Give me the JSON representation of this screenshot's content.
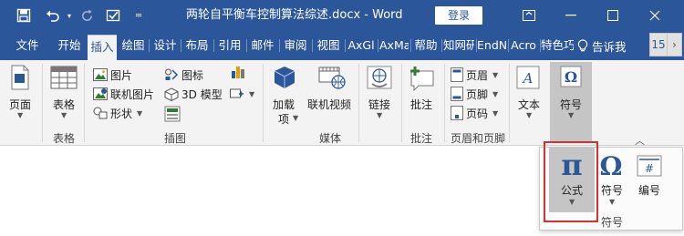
{
  "window": {
    "title": "两轮自平衡车控制算法综述.docx  -  Word",
    "login_label": "登录"
  },
  "quick_access": {
    "save_icon": "save-icon",
    "undo_icon": "undo-icon",
    "redo_icon": "redo-icon",
    "check_icon": "check-icon",
    "customize_icon": "customize-icon"
  },
  "tabs": [
    {
      "label": "文件"
    },
    {
      "label": "开始"
    },
    {
      "label": "插入",
      "active": true
    },
    {
      "label": "绘图"
    },
    {
      "label": "设计"
    },
    {
      "label": "布局"
    },
    {
      "label": "引用"
    },
    {
      "label": "邮件"
    },
    {
      "label": "审阅"
    },
    {
      "label": "视图"
    },
    {
      "label": "AxGl"
    },
    {
      "label": "AxMa"
    },
    {
      "label": "帮助"
    },
    {
      "label": "知网研"
    },
    {
      "label": "EndN"
    },
    {
      "label": "Acro"
    },
    {
      "label": "特色巧"
    }
  ],
  "tell_me": {
    "label": "告诉我"
  },
  "tab_scroll": {
    "label": "15"
  },
  "ribbon": {
    "pages": {
      "label": "页面"
    },
    "tables": {
      "label": "表格",
      "group": "表格"
    },
    "illustrations": {
      "group": "插图",
      "picture": "图片",
      "online_picture": "联机图片",
      "shapes": "形状",
      "icons": "图标",
      "model3d": "3D 模型"
    },
    "addins": {
      "label1": "加载",
      "label2": "项"
    },
    "online_video": {
      "label": "联机视频",
      "group": "媒体"
    },
    "links": {
      "label": "链接"
    },
    "comment": {
      "label": "批注",
      "group": "批注"
    },
    "header_footer": {
      "group": "页眉和页脚",
      "header": "页眉",
      "footer": "页脚",
      "page_number": "页码"
    },
    "text": {
      "label": "文本"
    },
    "symbols": {
      "label": "符号"
    }
  },
  "symbols_panel": {
    "equation": {
      "label": "公式",
      "glyph": "π"
    },
    "symbol": {
      "label": "符号",
      "glyph": "Ω"
    },
    "number": {
      "label": "编号",
      "glyph": "#"
    },
    "group_label": "符号"
  },
  "colors": {
    "brand_blue": "#2b579a",
    "highlight_red": "#d9312d"
  }
}
